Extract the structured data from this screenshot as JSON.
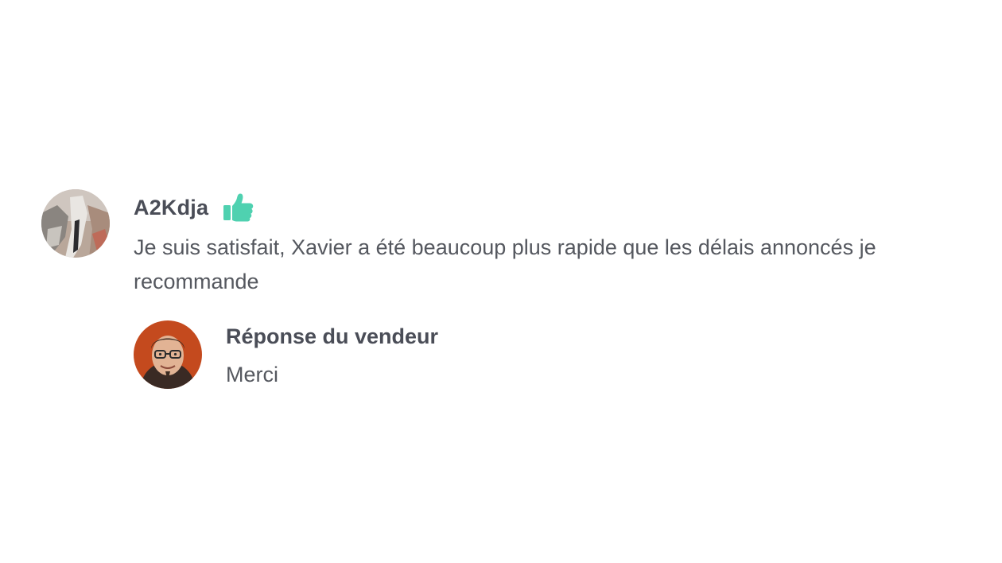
{
  "review": {
    "reviewer": {
      "name": "A2Kdja",
      "avatar_icon": "reviewer-avatar-image",
      "rating_icon": "thumbs-up-icon",
      "rating_color": "#4fd1b0"
    },
    "text": "Je suis satisfait, Xavier a été beaucoup plus rapide que les délais annoncés je recommande",
    "seller_reply": {
      "title": "Réponse du vendeur",
      "text": "Merci",
      "avatar_icon": "seller-avatar-image"
    }
  }
}
